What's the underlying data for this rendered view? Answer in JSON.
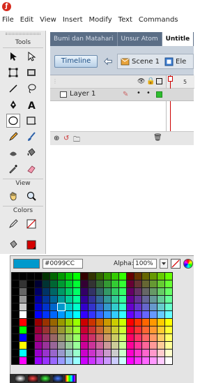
{
  "menubar": {
    "items": [
      "File",
      "Edit",
      "View",
      "Insert",
      "Modify",
      "Text",
      "Commands"
    ]
  },
  "tools": {
    "title": "Tools",
    "view_label": "View",
    "colors_label": "Colors",
    "stroke_color": "#333333",
    "fill_color": "#D40000"
  },
  "tabs": [
    {
      "label": "Bumi dan Matahari",
      "active": false
    },
    {
      "label": "Unsur Atom",
      "active": false
    },
    {
      "label": "Untitle",
      "active": true
    }
  ],
  "timeline": {
    "button_label": "Timeline",
    "scene_label": "Scene 1",
    "element_label": "Ele",
    "frame_number": "5"
  },
  "layers": [
    {
      "name": "Layer 1"
    }
  ],
  "color_picker": {
    "hex_value": "#0099CC",
    "alpha_label": "Alpha:",
    "alpha_value": "100%",
    "selected_color": "#0099CC"
  }
}
